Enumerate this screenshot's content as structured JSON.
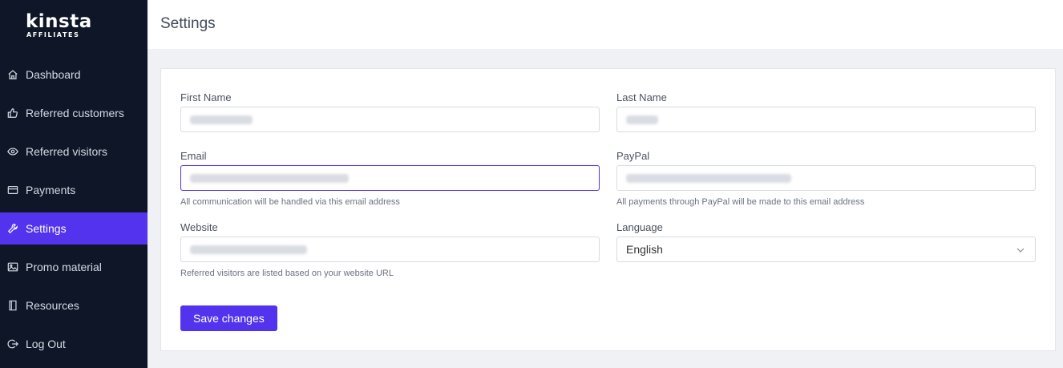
{
  "brand": {
    "name": "Kinsta",
    "sub": "AFFILIATES",
    "accent": "#5333ed",
    "sidebar_bg": "#0e1628"
  },
  "sidebar": {
    "items": [
      {
        "label": "Dashboard",
        "icon": "home-icon"
      },
      {
        "label": "Referred customers",
        "icon": "thumbs-up-icon"
      },
      {
        "label": "Referred visitors",
        "icon": "eye-icon"
      },
      {
        "label": "Payments",
        "icon": "credit-card-icon"
      },
      {
        "label": "Settings",
        "icon": "wrench-icon",
        "active": true
      },
      {
        "label": "Promo material",
        "icon": "image-icon"
      },
      {
        "label": "Resources",
        "icon": "book-icon"
      },
      {
        "label": "Log Out",
        "icon": "logout-icon"
      }
    ]
  },
  "header": {
    "title": "Settings"
  },
  "form": {
    "first_name": {
      "label": "First Name"
    },
    "last_name": {
      "label": "Last Name"
    },
    "email": {
      "label": "Email",
      "help": "All communication will be handled via this email address"
    },
    "paypal": {
      "label": "PayPal",
      "help": "All payments through PayPal will be made to this email address"
    },
    "website": {
      "label": "Website",
      "help": "Referred visitors are listed based on your website URL"
    },
    "language": {
      "label": "Language",
      "value": "English"
    },
    "save_label": "Save changes"
  }
}
